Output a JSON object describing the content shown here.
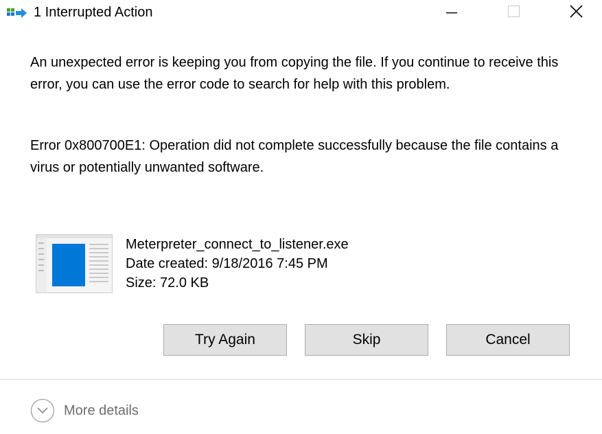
{
  "window": {
    "title": "1 Interrupted Action",
    "controls": {
      "minimize_icon": "minimize-icon",
      "maximize_icon": "maximize-icon",
      "close_icon": "close-icon"
    }
  },
  "dialog": {
    "message": "An unexpected error is keeping you from copying the file. If you continue to receive this error, you can use the error code to search for help with this problem.",
    "error": "Error 0x800700E1: Operation did not complete successfully because the file contains a virus or potentially unwanted software."
  },
  "file": {
    "name": "Meterpreter_connect_to_listener.exe",
    "date_created": "Date created: 9/18/2016 7:45 PM",
    "size": "Size: 72.0 KB",
    "icon": "file-thumbnail-icon"
  },
  "buttons": {
    "try_again": "Try Again",
    "skip": "Skip",
    "cancel": "Cancel"
  },
  "footer": {
    "more_details": "More details",
    "icon": "chevron-down-icon"
  },
  "colors": {
    "button_bg": "#e1e1e1",
    "button_border": "#adadad",
    "details_text": "#6d6d6d",
    "thumb_blue": "#0078d7"
  }
}
